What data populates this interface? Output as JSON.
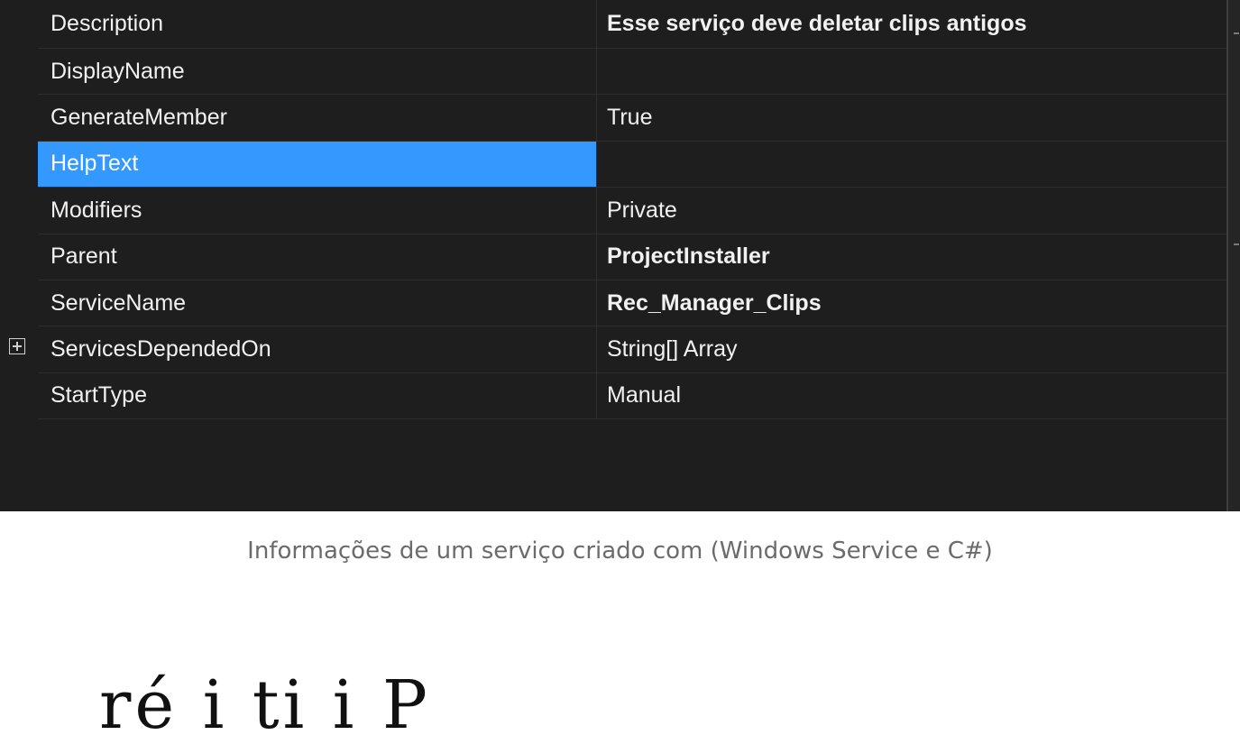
{
  "property_grid": {
    "rows": [
      {
        "name": "Description",
        "value": "Esse serviço deve deletar clips antigos",
        "value_bold": true,
        "selected": false,
        "expandable": false
      },
      {
        "name": "DisplayName",
        "value": "",
        "value_bold": false,
        "selected": false,
        "expandable": false
      },
      {
        "name": "GenerateMember",
        "value": "True",
        "value_bold": false,
        "selected": false,
        "expandable": false
      },
      {
        "name": "HelpText",
        "value": "",
        "value_bold": false,
        "selected": true,
        "expandable": false
      },
      {
        "name": "Modifiers",
        "value": "Private",
        "value_bold": false,
        "selected": false,
        "expandable": false
      },
      {
        "name": "Parent",
        "value": "ProjectInstaller",
        "value_bold": true,
        "selected": false,
        "expandable": false
      },
      {
        "name": "ServiceName",
        "value": "Rec_Manager_Clips",
        "value_bold": true,
        "selected": false,
        "expandable": false
      },
      {
        "name": "ServicesDependedOn",
        "value": "String[] Array",
        "value_bold": false,
        "selected": false,
        "expandable": true
      },
      {
        "name": "StartType",
        "value": "Manual",
        "value_bold": false,
        "selected": false,
        "expandable": false
      }
    ],
    "colors": {
      "background": "#1e1e1e",
      "text": "#f1f1f1",
      "selection": "#3399ff",
      "gridline": "#2d2d30"
    },
    "icons": {
      "expander": "plus-box-icon"
    }
  },
  "caption": "Informações de um serviço criado com (Windows Service e C#)"
}
